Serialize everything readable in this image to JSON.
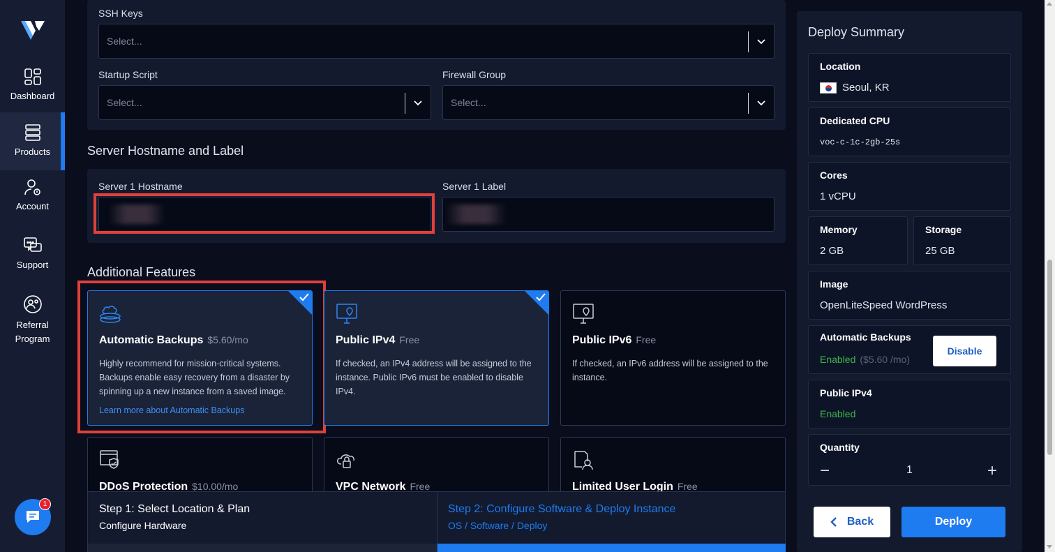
{
  "sidebar": {
    "items": [
      {
        "label": "Dashboard",
        "icon": "dashboard-icon"
      },
      {
        "label": "Products",
        "icon": "products-icon",
        "active": true
      },
      {
        "label": "Account",
        "icon": "account-icon"
      },
      {
        "label": "Support",
        "icon": "support-icon"
      },
      {
        "label": "Referral Program",
        "icon": "referral-icon"
      }
    ],
    "chat_badge": "1"
  },
  "ssh": {
    "label": "SSH Keys",
    "placeholder": "Select..."
  },
  "startup": {
    "label": "Startup Script",
    "placeholder": "Select..."
  },
  "firewall": {
    "label": "Firewall Group",
    "placeholder": "Select..."
  },
  "hostname_section": {
    "title": "Server Hostname and Label",
    "hostname_label": "Server 1 Hostname",
    "label_label": "Server 1 Label"
  },
  "features": {
    "title": "Additional Features",
    "cards": [
      {
        "title": "Automatic Backups",
        "price": "$5.60/mo",
        "desc": "Highly recommend for mission-critical systems. Backups enable easy recovery from a disaster by spinning up a new instance from a saved image.",
        "link": "Learn more about Automatic Backups",
        "selected": true
      },
      {
        "title": "Public IPv4",
        "price": "Free",
        "desc": "If checked, an IPv4 address will be assigned to the instance. Public IPv6 must be enabled to disable IPv4.",
        "selected": true
      },
      {
        "title": "Public IPv6",
        "price": "Free",
        "desc": "If checked, an IPv6 address will be assigned to the instance.",
        "selected": false
      },
      {
        "title": "DDoS Protection",
        "price": "$10.00/mo"
      },
      {
        "title": "VPC Network",
        "price": "Free"
      },
      {
        "title": "Limited User Login",
        "price": "Free"
      }
    ]
  },
  "steps": {
    "step1_title": "Step 1: Select Location & Plan",
    "step1_sub": "Configure Hardware",
    "step2_title": "Step 2: Configure Software & Deploy Instance",
    "step2_sub": "OS / Software / Deploy"
  },
  "summary": {
    "title": "Deploy Summary",
    "location_k": "Location",
    "location_v": "Seoul, KR",
    "cpu_k": "Dedicated CPU",
    "cpu_v": "voc-c-1c-2gb-25s",
    "cores_k": "Cores",
    "cores_v": "1 vCPU",
    "memory_k": "Memory",
    "memory_v": "2 GB",
    "storage_k": "Storage",
    "storage_v": "25 GB",
    "image_k": "Image",
    "image_v": "OpenLiteSpeed WordPress",
    "backups_k": "Automatic Backups",
    "backups_v": "Enabled",
    "backups_price": "($5.60 /mo)",
    "disable_btn": "Disable",
    "ipv4_k": "Public IPv4",
    "ipv4_v": "Enabled",
    "qty_k": "Quantity",
    "qty_v": "1",
    "minus": "−",
    "plus": "+",
    "back_btn": "Back",
    "deploy_btn": "Deploy"
  },
  "colors": {
    "accent": "#1e7bf0",
    "highlight": "#e0403c",
    "enabled": "#3bb54a"
  }
}
